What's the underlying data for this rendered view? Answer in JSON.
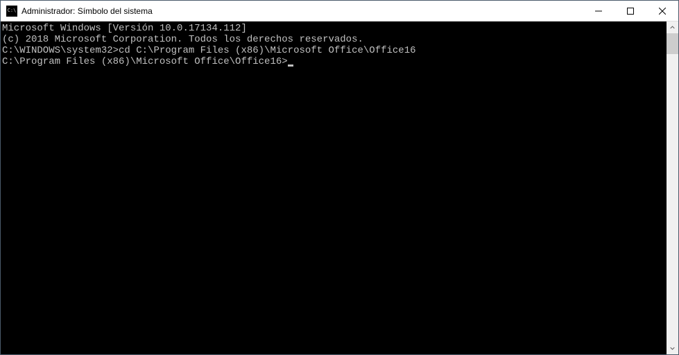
{
  "window": {
    "title": "Administrador: Símbolo del sistema",
    "icon_label": "C:\\"
  },
  "terminal": {
    "line1": "Microsoft Windows [Versión 10.0.17134.112]",
    "line2": "(c) 2018 Microsoft Corporation. Todos los derechos reservados.",
    "blank1": "",
    "prompt1": "C:\\WINDOWS\\system32>",
    "command1": "cd C:\\Program Files (x86)\\Microsoft Office\\Office16",
    "blank2": "",
    "prompt2": "C:\\Program Files (x86)\\Microsoft Office\\Office16>"
  }
}
